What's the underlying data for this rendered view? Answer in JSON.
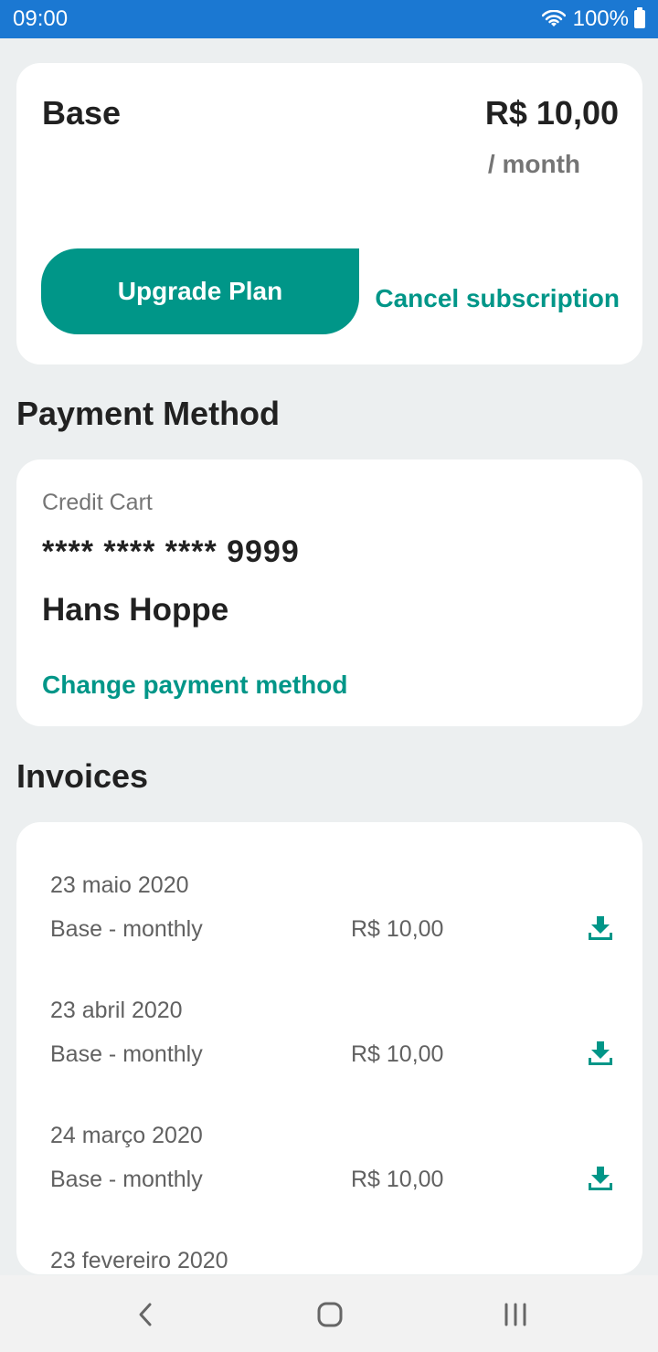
{
  "status_bar": {
    "time": "09:00",
    "battery": "100%"
  },
  "plan": {
    "name": "Base",
    "price": "R$ 10,00",
    "period": "/ month",
    "upgrade_label": "Upgrade Plan",
    "cancel_label": "Cancel subscription"
  },
  "payment": {
    "section_title": "Payment Method",
    "card_type": "Credit Cart",
    "card_number": "**** **** **** 9999",
    "holder": "Hans Hoppe",
    "change_label": "Change payment method"
  },
  "invoices": {
    "section_title": "Invoices",
    "items": [
      {
        "date": "23 maio 2020",
        "description": "Base - monthly",
        "amount": "R$ 10,00"
      },
      {
        "date": "23 abril 2020",
        "description": "Base - monthly",
        "amount": "R$ 10,00"
      },
      {
        "date": "24 março 2020",
        "description": "Base - monthly",
        "amount": "R$ 10,00"
      },
      {
        "date": "23 fevereiro 2020",
        "description": "",
        "amount": ""
      }
    ]
  },
  "icons": {
    "download": "download-icon",
    "wifi": "wifi-icon",
    "battery": "battery-icon",
    "back": "back-icon",
    "home": "home-icon",
    "recents": "recents-icon"
  },
  "colors": {
    "accent": "#009688",
    "status_bar": "#1b78d2",
    "background": "#eceff0"
  }
}
